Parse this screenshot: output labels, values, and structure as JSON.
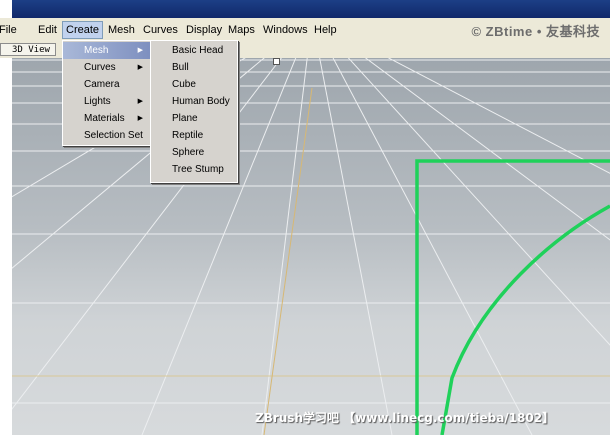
{
  "menubar": {
    "items": [
      "File",
      "Edit",
      "Create",
      "Mesh",
      "Curves",
      "Display",
      "Maps",
      "Windows",
      "Help"
    ],
    "active_index": 2
  },
  "watermark_top": "© ZBtime • 友基科技",
  "toolbar": {
    "view_tab": "3D View"
  },
  "create_menu": {
    "items": [
      {
        "label": "Mesh",
        "has_submenu": true,
        "highlighted": true
      },
      {
        "label": "Curves",
        "has_submenu": true,
        "highlighted": false
      },
      {
        "label": "Camera",
        "has_submenu": false,
        "highlighted": false
      },
      {
        "label": "Lights",
        "has_submenu": true,
        "highlighted": false
      },
      {
        "label": "Materials",
        "has_submenu": true,
        "highlighted": false
      },
      {
        "label": "Selection Set",
        "has_submenu": false,
        "highlighted": false
      }
    ]
  },
  "mesh_submenu": {
    "items": [
      "Basic Head",
      "Bull",
      "Cube",
      "Human Body",
      "Plane",
      "Reptile",
      "Sphere",
      "Tree Stump"
    ]
  },
  "watermark_bottom": "ZBrush学习吧 【www.linecg.com/tieba/1802】",
  "colors": {
    "menubar_bg": "#ece9d8",
    "menu_bg": "#d6d3ce",
    "highlight": "#7d8fbf",
    "grid_line": "#e8eaec",
    "axis_yellow": "#c8b27a",
    "curve_green": "#1fd15a"
  },
  "icons": {
    "submenu_arrow": "triangle-right-icon"
  }
}
